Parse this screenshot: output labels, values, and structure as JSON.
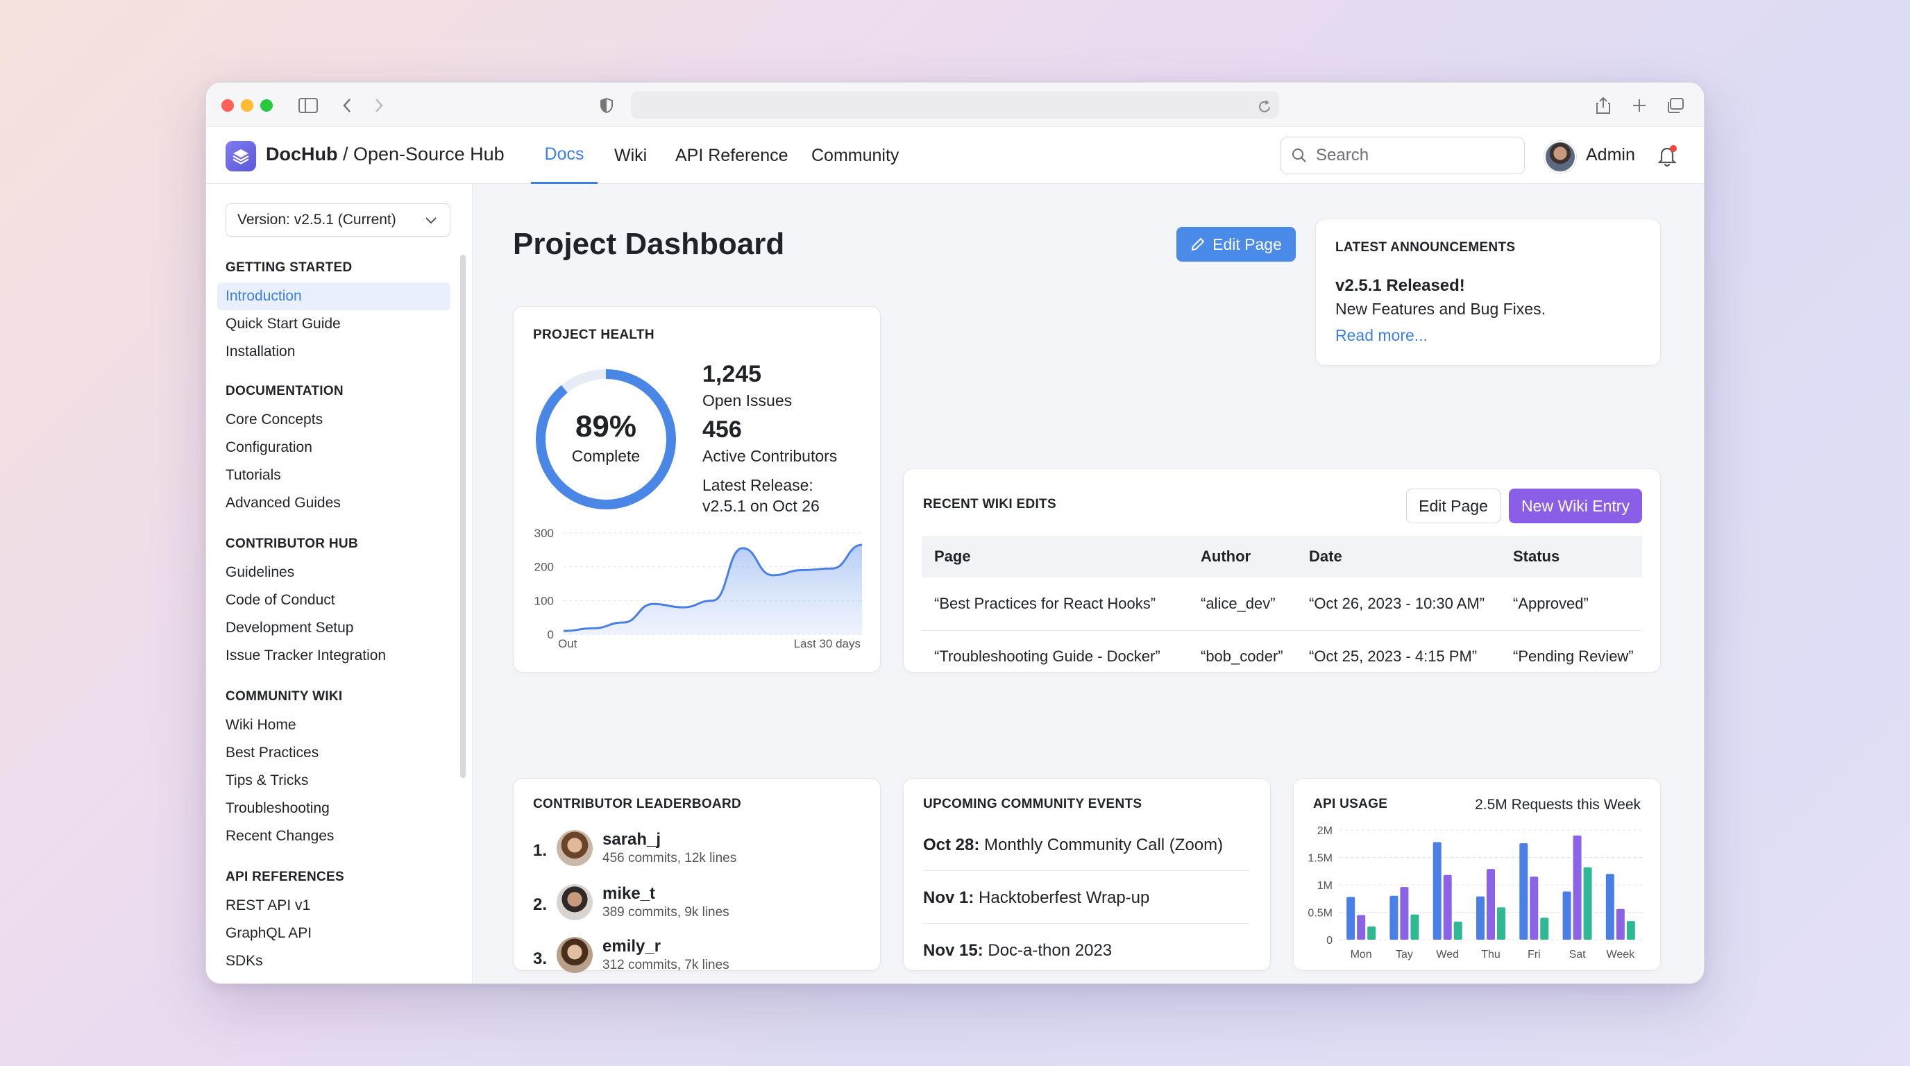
{
  "app": {
    "brand": "DocHub",
    "brand_suffix": " / Open-Source Hub",
    "nav": [
      "Docs",
      "Wiki",
      "API Reference",
      "Community"
    ],
    "active_nav": "Docs",
    "search_placeholder": "Search",
    "user_name": "Admin"
  },
  "sidebar": {
    "version": "Version: v2.5.1 (Current)",
    "sections": [
      {
        "title": "GETTING STARTED",
        "items": [
          "Introduction",
          "Quick Start Guide",
          "Installation"
        ]
      },
      {
        "title": "DOCUMENTATION",
        "items": [
          "Core Concepts",
          "Configuration",
          "Tutorials",
          "Advanced Guides"
        ]
      },
      {
        "title": "CONTRIBUTOR HUB",
        "items": [
          "Guidelines",
          "Code of Conduct",
          "Development Setup",
          "Issue Tracker Integration"
        ]
      },
      {
        "title": "COMMUNITY WIKI",
        "items": [
          "Wiki Home",
          "Best Practices",
          "Tips & Tricks",
          "Troubleshooting",
          "Recent Changes"
        ]
      },
      {
        "title": "API REFERENCES",
        "items": [
          "REST API v1",
          "GraphQL API",
          "SDKs"
        ]
      }
    ],
    "active_item": "Introduction"
  },
  "main": {
    "title": "Project Dashboard",
    "edit_page": "Edit Page"
  },
  "announcements": {
    "title": "LATEST ANNOUNCEMENTS",
    "headline": "v2.5.1 Released!",
    "body": "New Features and Bug Fixes.",
    "link": "Read more..."
  },
  "health": {
    "title": "PROJECT HEALTH",
    "percent_text": "89%",
    "percent": 0.89,
    "percent_label": "Complete",
    "issues": "1,245",
    "issues_label": "Open Issues",
    "contributors": "456",
    "contributors_label": "Active Contributors",
    "release_label": "Latest Release:",
    "release_value": "v2.5.1 on Oct 26",
    "x_start": "Out",
    "x_end": "Last 30 days"
  },
  "wiki": {
    "title": "RECENT WIKI EDITS",
    "edit_btn": "Edit Page",
    "new_btn": "New Wiki Entry",
    "columns": [
      "Page",
      "Author",
      "Date",
      "Status"
    ],
    "rows": [
      [
        "“Best Practices for React Hooks”",
        "“alice_dev”",
        "“Oct 26, 2023 - 10:30 AM”",
        "“Approved”"
      ],
      [
        "“Troubleshooting Guide - Docker”",
        "“bob_coder”",
        "“Oct 25, 2023 - 4:15 PM”",
        "“Pending Review”"
      ]
    ]
  },
  "leaderboard": {
    "title": "CONTRIBUTOR LEADERBOARD",
    "entries": [
      {
        "rank": "1.",
        "name": "sarah_j",
        "stats": "456 commits, 12k lines"
      },
      {
        "rank": "2.",
        "name": "mike_t",
        "stats": "389 commits, 9k lines"
      },
      {
        "rank": "3.",
        "name": "emily_r",
        "stats": "312 commits, 7k lines"
      }
    ]
  },
  "events": {
    "title": "UPCOMING COMMUNITY EVENTS",
    "items": [
      {
        "date": "Oct 28:",
        "name": " Monthly Community Call (Zoom)"
      },
      {
        "date": "Nov 1:",
        "name": " Hacktoberfest Wrap-up"
      },
      {
        "date": "Nov 15:",
        "name": " Doc-a-thon 2023"
      }
    ]
  },
  "api": {
    "title": "API USAGE",
    "summary": "2.5M Requests this Week"
  },
  "colors": {
    "accent": "#3b7fe0",
    "violet": "#8b5ee8",
    "bar_blue": "#4a7fe6",
    "bar_purple": "#8b63e6",
    "bar_teal": "#2fb894"
  },
  "chart_data": [
    {
      "type": "area",
      "x": [
        "Out",
        "",
        "",
        "",
        "",
        "",
        "",
        "",
        "",
        "",
        "Last 30 days"
      ],
      "yticks": [
        "300",
        "200",
        "100",
        "0"
      ],
      "ylim": [
        0,
        300
      ],
      "values": [
        10,
        18,
        35,
        90,
        80,
        100,
        255,
        175,
        190,
        195,
        265
      ]
    },
    {
      "type": "bar",
      "categories": [
        "Mon",
        "Tay",
        "Wed",
        "Thu",
        "Fri",
        "Sat",
        "Week"
      ],
      "yticks": [
        "2M",
        "1.5M",
        "1M",
        "0.5M",
        "0"
      ],
      "ylim": [
        0,
        2000000
      ],
      "series": [
        {
          "values": [
            780000,
            800000,
            1780000,
            790000,
            1760000,
            880000,
            1200000
          ]
        },
        {
          "values": [
            450000,
            960000,
            1180000,
            1290000,
            1150000,
            1900000,
            560000
          ]
        },
        {
          "values": [
            240000,
            460000,
            330000,
            590000,
            400000,
            1320000,
            340000
          ]
        }
      ]
    }
  ]
}
